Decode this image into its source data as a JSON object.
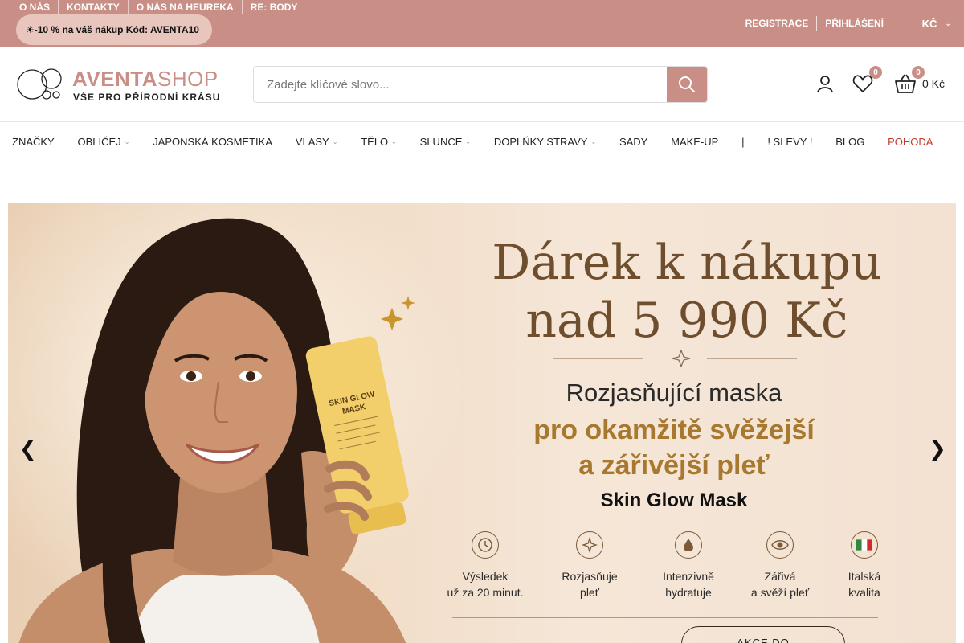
{
  "topbar": {
    "links": [
      {
        "label": "O NÁS"
      },
      {
        "label": "KONTAKTY"
      },
      {
        "label": "O NÁS NA HEUREKA"
      },
      {
        "label": "RE: BODY"
      }
    ],
    "promo": "☀-10 % na váš nákup Kód: AVENTA10",
    "register": "REGISTRACE",
    "login": "PŘIHLÁŠENÍ",
    "currency": "KČ"
  },
  "header": {
    "logo": {
      "brand_bold": "AVENTA",
      "brand_light": "SHOP",
      "tagline": "VŠE PRO PŘÍRODNÍ KRÁSU"
    },
    "search": {
      "placeholder": "Zadejte klíčové slovo..."
    },
    "wishlist_count": "0",
    "cart_count": "0",
    "cart_total": "0 Kč"
  },
  "nav": {
    "items": [
      {
        "label": "ZNAČKY"
      },
      {
        "label": "OBLIČEJ"
      },
      {
        "label": "JAPONSKÁ KOSMETIKA"
      },
      {
        "label": "VLASY"
      },
      {
        "label": "TĚLO"
      },
      {
        "label": "SLUNCE"
      },
      {
        "label": "DOPLŇKY STRAVY"
      },
      {
        "label": "SADY"
      },
      {
        "label": "MAKE-UP"
      },
      {
        "label": "|"
      },
      {
        "label": "! SLEVY !"
      },
      {
        "label": "BLOG"
      },
      {
        "label": "POHODA"
      }
    ]
  },
  "hero": {
    "title_line1": "Dárek k nákupu",
    "title_line2": "nad 5 990 Kč",
    "subtitle": "Rozjasňující maska",
    "highlight_line1": "pro okamžitě svěžejší",
    "highlight_line2": "a zářivější pleť",
    "product": "Skin Glow Mask",
    "tube_label_line1": "SKIN GLOW",
    "tube_label_line2": "MASK",
    "features": [
      {
        "icon": "clock-icon",
        "line1": "Výsledek",
        "line2": "už za 20 minut."
      },
      {
        "icon": "sparkle-icon",
        "line1": "Rozjasňuje",
        "line2": "pleť"
      },
      {
        "icon": "drop-icon",
        "line1": "Intenzivně",
        "line2": "hydratuje"
      },
      {
        "icon": "eye-icon",
        "line1": "Zářivá",
        "line2": "a svěží pleť"
      },
      {
        "icon": "italy-flag-icon",
        "line1": "Italská",
        "line2": "kvalita"
      }
    ],
    "cta": "AKCE DO",
    "prev_arrow": "❮",
    "next_arrow": "❯"
  },
  "colors": {
    "accent": "#c98f86",
    "gold": "#a7782e",
    "title_brown": "#6e4e2d",
    "sale_red": "#c0392b"
  }
}
